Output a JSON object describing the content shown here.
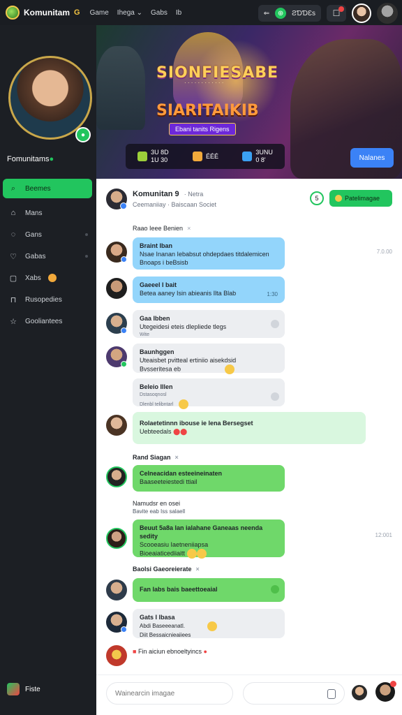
{
  "topbar": {
    "brand": "Komunitam",
    "coin_label": "G",
    "nav": [
      "Game",
      "Ihega",
      "Gabs",
      "Ib"
    ],
    "nav_dropdown_index": 1,
    "balance": "ƧƊƊƐs"
  },
  "sidebar": {
    "username": "Fomunitams",
    "verified_mark": "●",
    "items": [
      {
        "label": "Beemes",
        "icon": "search-icon",
        "active": true
      },
      {
        "label": "Mans",
        "icon": "home-icon"
      },
      {
        "label": "Gans",
        "icon": "chat-icon"
      },
      {
        "label": "Gabas",
        "icon": "heart-icon"
      },
      {
        "label": "Xabs",
        "icon": "square-icon"
      },
      {
        "label": "Rusopedies",
        "icon": "bag-icon"
      },
      {
        "label": "Gooliantees",
        "icon": "star-icon"
      }
    ],
    "bottom_label": "Fiste"
  },
  "banner": {
    "title": "SIONFIESABE",
    "subtitle": "· · · · · · · · · · · ·",
    "title2": "SIARITAIKIB",
    "tag": "Ebani tanits Rigens",
    "stats": [
      {
        "top": "3U 8D",
        "bottom": "1U 30"
      },
      {
        "top": "ÉÉÉ",
        "bottom": ""
      },
      {
        "top": "3UNU",
        "bottom": "0 8'"
      }
    ],
    "button": "Nalanes"
  },
  "chat": {
    "title": "Komunitan",
    "title_extra": "9",
    "title_aux": "· Netra",
    "subtitle": "Ceemaniiay · Baiscaan Societ",
    "count": "5",
    "action_button": "Patelimagae"
  },
  "messages": [
    {
      "type": "label",
      "text": "Raao Ieee Benien",
      "extra": "×"
    },
    {
      "type": "bubble",
      "color": "blue",
      "name": "Braint Iban",
      "line1": "Nsae Inanan Iebabsut ohdepdaes titdalemicen",
      "line2": "Bnoaps i beBsisb",
      "time": "7.0.00"
    },
    {
      "type": "bubble",
      "color": "blue",
      "name": "Gaeeel I bait",
      "line1": "Betea aaney Isin abieanis Ilta Blab",
      "line2": "",
      "time": "1:30"
    },
    {
      "type": "bubble",
      "color": "gray",
      "name": "Gaa Ibben",
      "line1": "Utegeidesi eteis dlepliede tlegs",
      "line2": "Wite",
      "time": ""
    },
    {
      "type": "bubble",
      "color": "gray",
      "name": "Baunhggen",
      "line1": "Uteaisbet pvitteal ertiniio aisekdsid",
      "line2": "Bvsseritesa eb",
      "time": ""
    },
    {
      "type": "bubble",
      "color": "gray",
      "name": "Beleio Illen",
      "line1": "Dstasoqnosl",
      "line2": "Dlenbl telibntarl",
      "time": ""
    },
    {
      "type": "bubble",
      "color": "lgreen",
      "name": "Rolaetetinnn ibouse ie lena Bersegset",
      "line1": "Uebteedals",
      "line2": "",
      "time": ""
    },
    {
      "type": "label",
      "text": "Rand Siagan",
      "extra": "×"
    },
    {
      "type": "bubble",
      "color": "green",
      "name": "Celneacidan esteeineinaten",
      "line1": "Baaseeteiestedi ttiail",
      "line2": "",
      "time": ""
    },
    {
      "type": "label",
      "text": "Namudsr en osei",
      "extra": "Bavite eab Iss salaell"
    },
    {
      "type": "bubble",
      "color": "green",
      "name": "Beuut 5a8a lan ialahane Ganeaas neenda sedity",
      "line1": "Scooeasiu Iaetneniiapsa",
      "line2": "Bioeaiaticediiaitt",
      "time": "12:001"
    },
    {
      "type": "label",
      "text": "Baolsi Gaeoreierate",
      "extra": "×"
    },
    {
      "type": "bubble",
      "color": "green",
      "name": "Fan labs bais baeettoeaial",
      "line1": "",
      "line2": "",
      "time": ""
    },
    {
      "type": "bubble",
      "color": "gray",
      "name": "Gats I lbasa",
      "line1": "Abdi Baseeeanatl.",
      "line2": "Diit Bessaicnieaiiees",
      "time": ""
    },
    {
      "type": "label",
      "text": "Fin aiciun ebnoeltyincs",
      "extra": ""
    }
  ],
  "composer": {
    "placeholder": "Wainearcin imagae"
  },
  "colors": {
    "accent": "#22c55e",
    "topbar": "#1a1d22",
    "sidebar": "#1c1f24",
    "blue_bubble": "#93d5fb",
    "green_bubble": "#6fd86a"
  }
}
